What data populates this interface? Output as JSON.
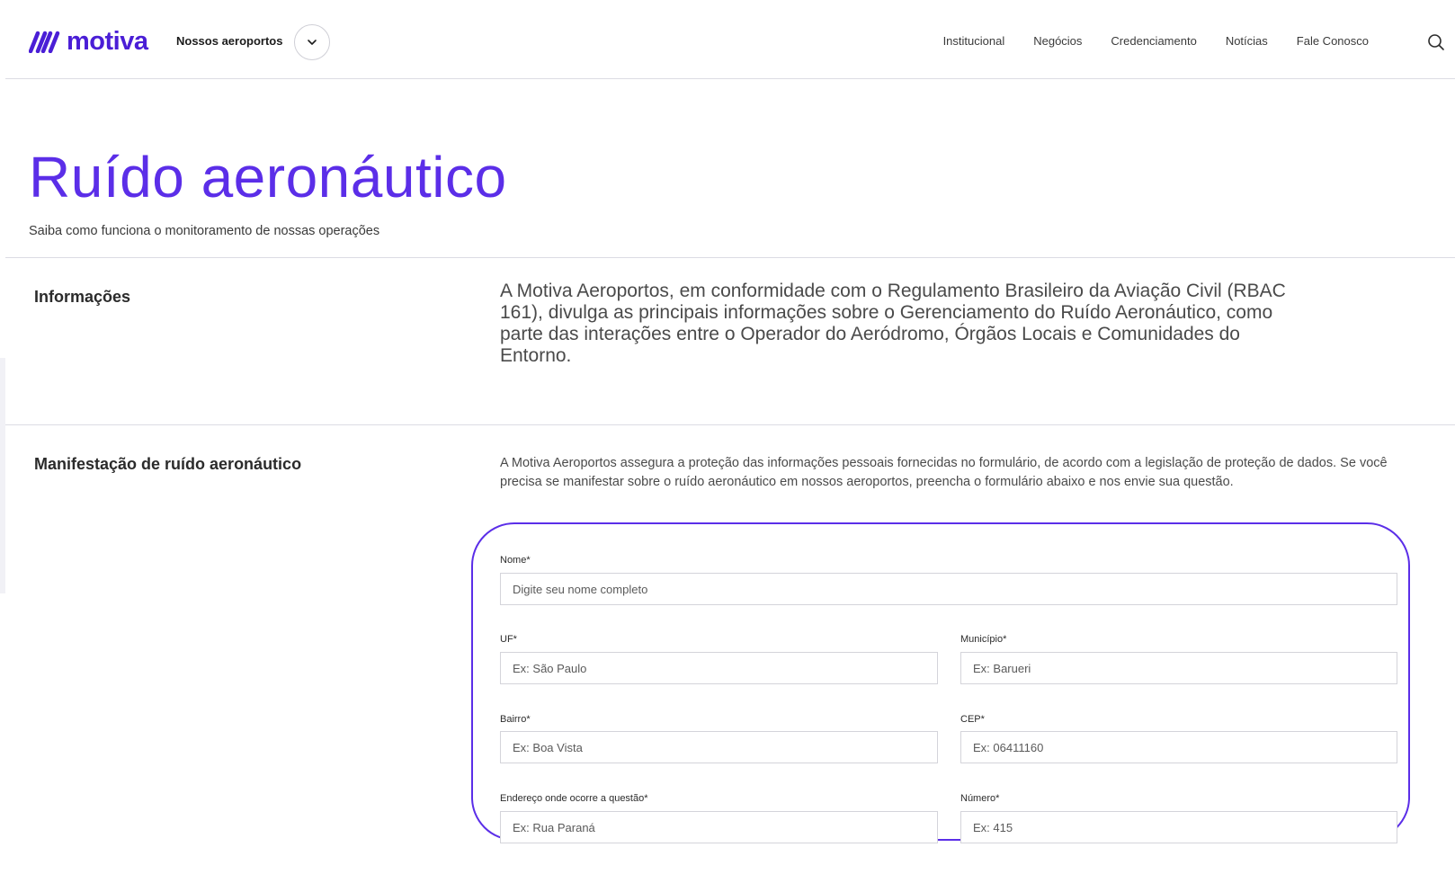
{
  "header": {
    "logo_text": "motiva",
    "airports_label": "Nossos aeroportos",
    "nav": [
      "Institucional",
      "Negócios",
      "Credenciamento",
      "Notícias",
      "Fale Conosco"
    ]
  },
  "hero": {
    "title": "Ruído aeronáutico",
    "subtitle": "Saiba como funciona o monitoramento de nossas operações"
  },
  "info": {
    "label": "Informações",
    "text": "A Motiva Aeroportos, em conformidade com o Regulamento Brasileiro da Aviação Civil (RBAC 161), divulga as principais informações sobre o Gerenciamento do Ruído Aeronáutico, como parte das interações entre o Operador do Aeródromo, Órgãos Locais e Comunidades do Entorno."
  },
  "manifestation": {
    "label": "Manifestação de ruído aeronáutico",
    "text": "A Motiva Aeroportos assegura a proteção das informações pessoais fornecidas no formulário, de acordo com a legislação de proteção de dados.   Se você precisa se manifestar sobre o ruído aeronáutico em nossos aeroportos, preencha o formulário abaixo e nos envie sua questão."
  },
  "form": {
    "nome": {
      "label": "Nome*",
      "placeholder": "Digite seu nome completo"
    },
    "uf": {
      "label": "UF*",
      "placeholder": "Ex: São Paulo"
    },
    "municipio": {
      "label": "Município*",
      "placeholder": "Ex: Barueri"
    },
    "bairro": {
      "label": "Bairro*",
      "placeholder": "Ex: Boa Vista"
    },
    "cep": {
      "label": "CEP*",
      "placeholder": "Ex: 06411160"
    },
    "endereco": {
      "label": "Endereço onde ocorre a questão*",
      "placeholder": "Ex: Rua Paraná"
    },
    "numero": {
      "label": "Número*",
      "placeholder": "Ex: 415"
    }
  },
  "colors": {
    "accent": "#5b2ee8",
    "brand": "#4a1ed6"
  }
}
